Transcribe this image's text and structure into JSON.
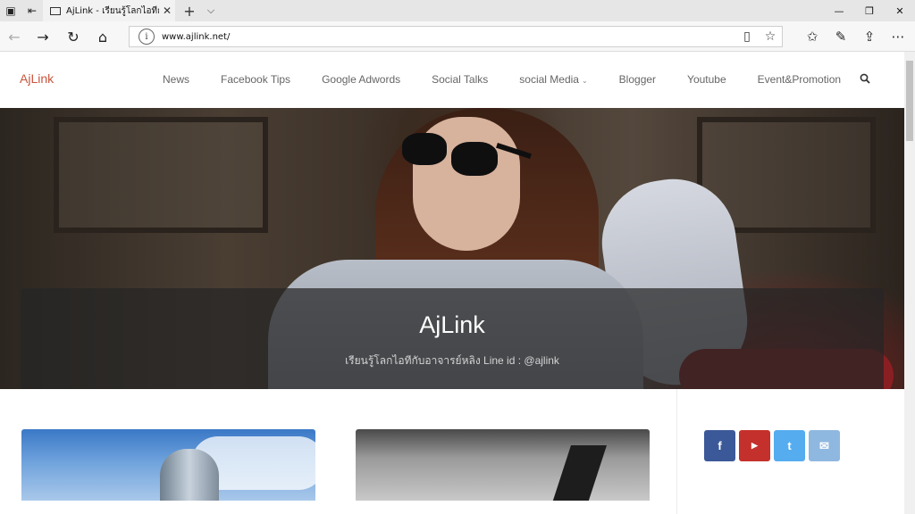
{
  "browser": {
    "tab_title": "AjLink - เรียนรู้โลกไอทีกับอ",
    "tab_close": "✕",
    "new_tab": "+",
    "tab_menu": "⌵",
    "url": "www.ajlink.net/",
    "window_controls": {
      "minimize": "—",
      "restore": "❐",
      "close": "✕"
    },
    "nav_icons": [
      "back-icon",
      "forward-icon",
      "refresh-icon",
      "home-icon"
    ],
    "toolbar_icons": [
      "favorites-icon",
      "pen-icon",
      "share-icon",
      "more-icon"
    ]
  },
  "site": {
    "logo": "AjLink",
    "menu": [
      {
        "label": "News"
      },
      {
        "label": "Facebook Tips"
      },
      {
        "label": "Google Adwords"
      },
      {
        "label": "Social Talks"
      },
      {
        "label": "social Media",
        "caret": "⌄"
      },
      {
        "label": "Blogger"
      },
      {
        "label": "Youtube"
      },
      {
        "label": "Event&Promotion"
      }
    ]
  },
  "hero": {
    "title": "AjLink",
    "subtitle": "เรียนรู้โลกไอทีกับอาจารย์หลิง Line id : @ajlink"
  },
  "social": [
    {
      "name": "facebook",
      "glyph": "f",
      "color": "#3b5998"
    },
    {
      "name": "youtube",
      "glyph": "▶",
      "color": "#c4302b"
    },
    {
      "name": "twitter",
      "glyph": "t",
      "color": "#55acee"
    },
    {
      "name": "email",
      "glyph": "✉",
      "color": "#8fb8e0"
    }
  ]
}
